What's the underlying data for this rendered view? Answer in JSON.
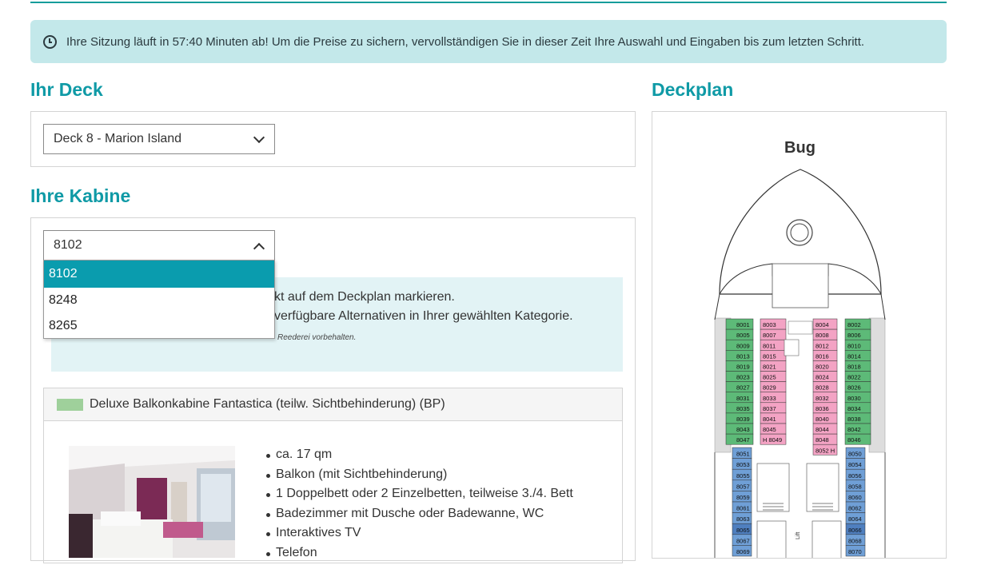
{
  "banner": {
    "text": "Ihre Sitzung läuft in 57:40 Minuten ab! Um die Preise zu sichern, vervollständigen Sie in dieser Zeit Ihre Auswahl und Eingaben bis zum letzten Schritt."
  },
  "deck": {
    "heading": "Ihr Deck",
    "selected": "Deck 8 - Marion Island"
  },
  "cabin": {
    "heading": "Ihre Kabine",
    "selected": "8102",
    "options": [
      "8102",
      "8248",
      "8265"
    ],
    "info_line1": "kt auf dem Deckplan markieren.",
    "info_line2": "verfügbare Alternativen in Ihrer gewählten Kategorie.",
    "info_note": "Reederei vorbehalten.",
    "category": {
      "name": "Deluxe Balkonkabine Fantastica (teilw. Sichtbehinderung) (BP)",
      "color": "#9fd09b",
      "features": [
        "ca. 17 qm",
        "Balkon (mit Sichtbehinderung)",
        "1 Doppelbett oder 2 Einzelbetten, teilweise 3./4. Bett",
        "Badezimmer mit Dusche oder Badewanne, WC",
        "Interaktives TV",
        "Telefon"
      ]
    }
  },
  "deckplan": {
    "heading": "Deckplan",
    "bow_label": "Bug",
    "lift_label": "Lift",
    "colors": {
      "green": "#5dba78",
      "pink": "#f3a3c4",
      "blue": "#6f9fd6",
      "darkblue": "#4f7fbf"
    },
    "left_green": [
      "8001",
      "8005",
      "8009",
      "8013",
      "8019",
      "8023",
      "8027",
      "8031",
      "8035",
      "8039",
      "8043",
      "8047"
    ],
    "inner_left_pink": [
      "8003",
      "8007",
      "8011",
      "8015",
      "8021",
      "8025",
      "8029",
      "8033",
      "8037",
      "8041",
      "8045",
      "H 8049"
    ],
    "inner_right_pink": [
      "8004",
      "8008",
      "8012",
      "8016",
      "8020",
      "8024",
      "8028",
      "8032",
      "8036",
      "8040",
      "8044",
      "8048",
      "8052 H"
    ],
    "right_green": [
      "8002",
      "8006",
      "8010",
      "8014",
      "8018",
      "8022",
      "8026",
      "8030",
      "8034",
      "8038",
      "8042",
      "8046"
    ],
    "left_blue": [
      "8051",
      "8053",
      "8055",
      "8057",
      "8059",
      "8061",
      "8063",
      "8065",
      "8067",
      "8069"
    ],
    "right_blue": [
      "8050",
      "8054",
      "8056",
      "8058",
      "8060",
      "8062",
      "8064",
      "8066",
      "8068",
      "8070"
    ]
  }
}
